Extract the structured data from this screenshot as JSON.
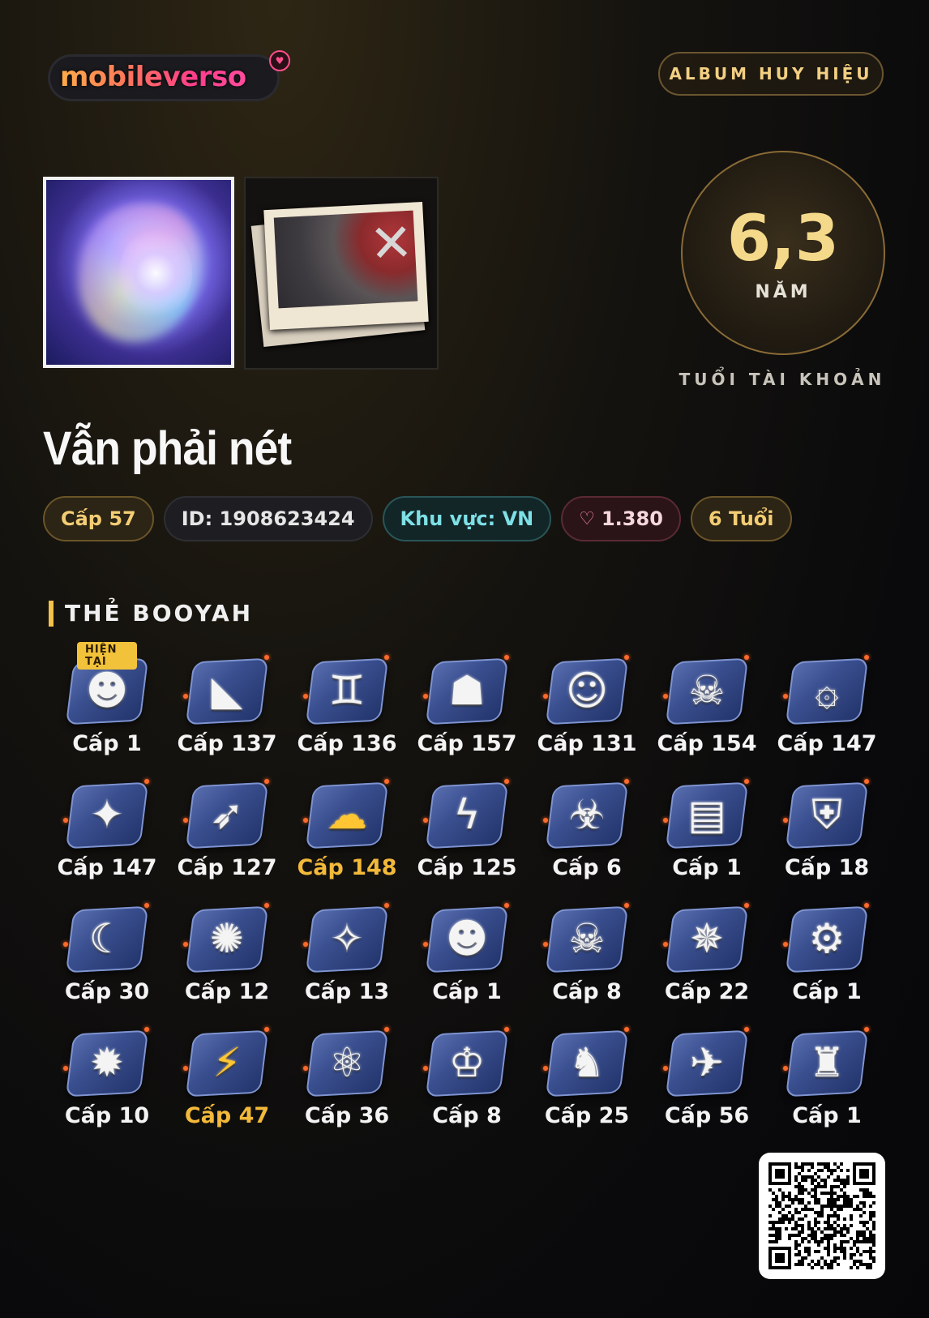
{
  "brand": {
    "logo_text": "mobileverso"
  },
  "header": {
    "album_button": "ALBUM HUY HIỆU"
  },
  "account_age": {
    "value": "6,3",
    "unit": "NĂM",
    "caption": "TUỔI TÀI KHOẢN"
  },
  "player": {
    "name": "Vẫn phải nét",
    "level": "Cấp 57",
    "id": "ID: 1908623424",
    "region": "Khu vực: VN",
    "likes": "1.380",
    "age": "6 Tuổi"
  },
  "booyah": {
    "title": "THẺ BOOYAH",
    "current_label": "HIỆN TẠI",
    "cards": [
      {
        "label": "Cấp 1",
        "icon": "apple-face-icon",
        "current": true
      },
      {
        "label": "Cấp 137",
        "icon": "wolf-icon"
      },
      {
        "label": "Cấp 136",
        "icon": "gemini-icon"
      },
      {
        "label": "Cấp 157",
        "icon": "warrior-face-icon"
      },
      {
        "label": "Cấp 131",
        "icon": "sunglasses-smiley-icon"
      },
      {
        "label": "Cấp 154",
        "icon": "skull-gear-icon"
      },
      {
        "label": "Cấp 147",
        "icon": "vortex-icon"
      },
      {
        "label": "Cấp 147",
        "icon": "fox-icon"
      },
      {
        "label": "Cấp 127",
        "icon": "archer-icon"
      },
      {
        "label": "Cấp 148",
        "icon": "ghost-icon",
        "gold": true
      },
      {
        "label": "Cấp 125",
        "icon": "storm-icon"
      },
      {
        "label": "Cấp 6",
        "icon": "demon-mask-icon"
      },
      {
        "label": "Cấp 1",
        "icon": "tv-icon"
      },
      {
        "label": "Cấp 18",
        "icon": "shield-skull-icon"
      },
      {
        "label": "Cấp 30",
        "icon": "moon-bear-icon"
      },
      {
        "label": "Cấp 12",
        "icon": "dragon-head-icon"
      },
      {
        "label": "Cấp 13",
        "icon": "compass-star-icon"
      },
      {
        "label": "Cấp 1",
        "icon": "frog-icon"
      },
      {
        "label": "Cấp 8",
        "icon": "beast-skull-icon"
      },
      {
        "label": "Cấp 22",
        "icon": "phoenix-icon"
      },
      {
        "label": "Cấp 1",
        "icon": "robot-icon"
      },
      {
        "label": "Cấp 10",
        "icon": "puffball-icon"
      },
      {
        "label": "Cấp 47",
        "icon": "lightning-icon",
        "gold": true
      },
      {
        "label": "Cấp 36",
        "icon": "atom-icon"
      },
      {
        "label": "Cấp 8",
        "icon": "crowned-skull-icon"
      },
      {
        "label": "Cấp 25",
        "icon": "elephant-icon"
      },
      {
        "label": "Cấp 56",
        "icon": "eagle-icon"
      },
      {
        "label": "Cấp 1",
        "icon": "crocodile-icon"
      }
    ]
  },
  "colors": {
    "gold": "#f3cd74",
    "accent_orange": "#f3b93a",
    "region": "#7ee0e6",
    "likes_heart": "#ff8aa3"
  }
}
